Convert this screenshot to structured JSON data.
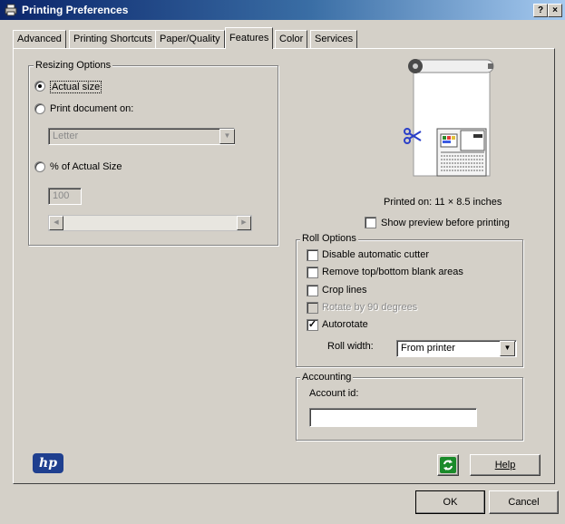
{
  "window": {
    "title": "Printing Preferences",
    "help_button": "?",
    "close_button": "×"
  },
  "tabs": [
    {
      "label": "Advanced"
    },
    {
      "label": "Printing Shortcuts"
    },
    {
      "label": "Paper/Quality"
    },
    {
      "label": "Features",
      "active": true
    },
    {
      "label": "Color"
    },
    {
      "label": "Services"
    }
  ],
  "resizing": {
    "legend": "Resizing Options",
    "actual_size": "Actual size",
    "print_document_on": "Print document on:",
    "paper_select": "Letter",
    "percent_of_actual": "% of Actual Size",
    "percent_value": "100",
    "selected": "actual_size"
  },
  "preview": {
    "printed_on": "Printed on: 11 × 8.5 inches",
    "show_preview": "Show preview before printing"
  },
  "roll_options": {
    "legend": "Roll Options",
    "disable_cutter": "Disable automatic cutter",
    "remove_blank": "Remove top/bottom blank areas",
    "crop_lines": "Crop lines",
    "rotate_90": "Rotate by 90 degrees",
    "autorotate": "Autorotate",
    "roll_width_label": "Roll width:",
    "roll_width_value": "From printer"
  },
  "accounting": {
    "legend": "Accounting",
    "account_id_label": "Account id:",
    "account_id_value": ""
  },
  "buttons": {
    "help": "Help",
    "ok": "OK",
    "cancel": "Cancel"
  },
  "logo": "hp",
  "colors": {
    "titlebar_start": "#0a246a",
    "titlebar_end": "#a6caf0",
    "dialog_bg": "#d4d0c8",
    "refresh_icon": "#1a8a2a",
    "hp_logo": "#1f3f8f"
  }
}
